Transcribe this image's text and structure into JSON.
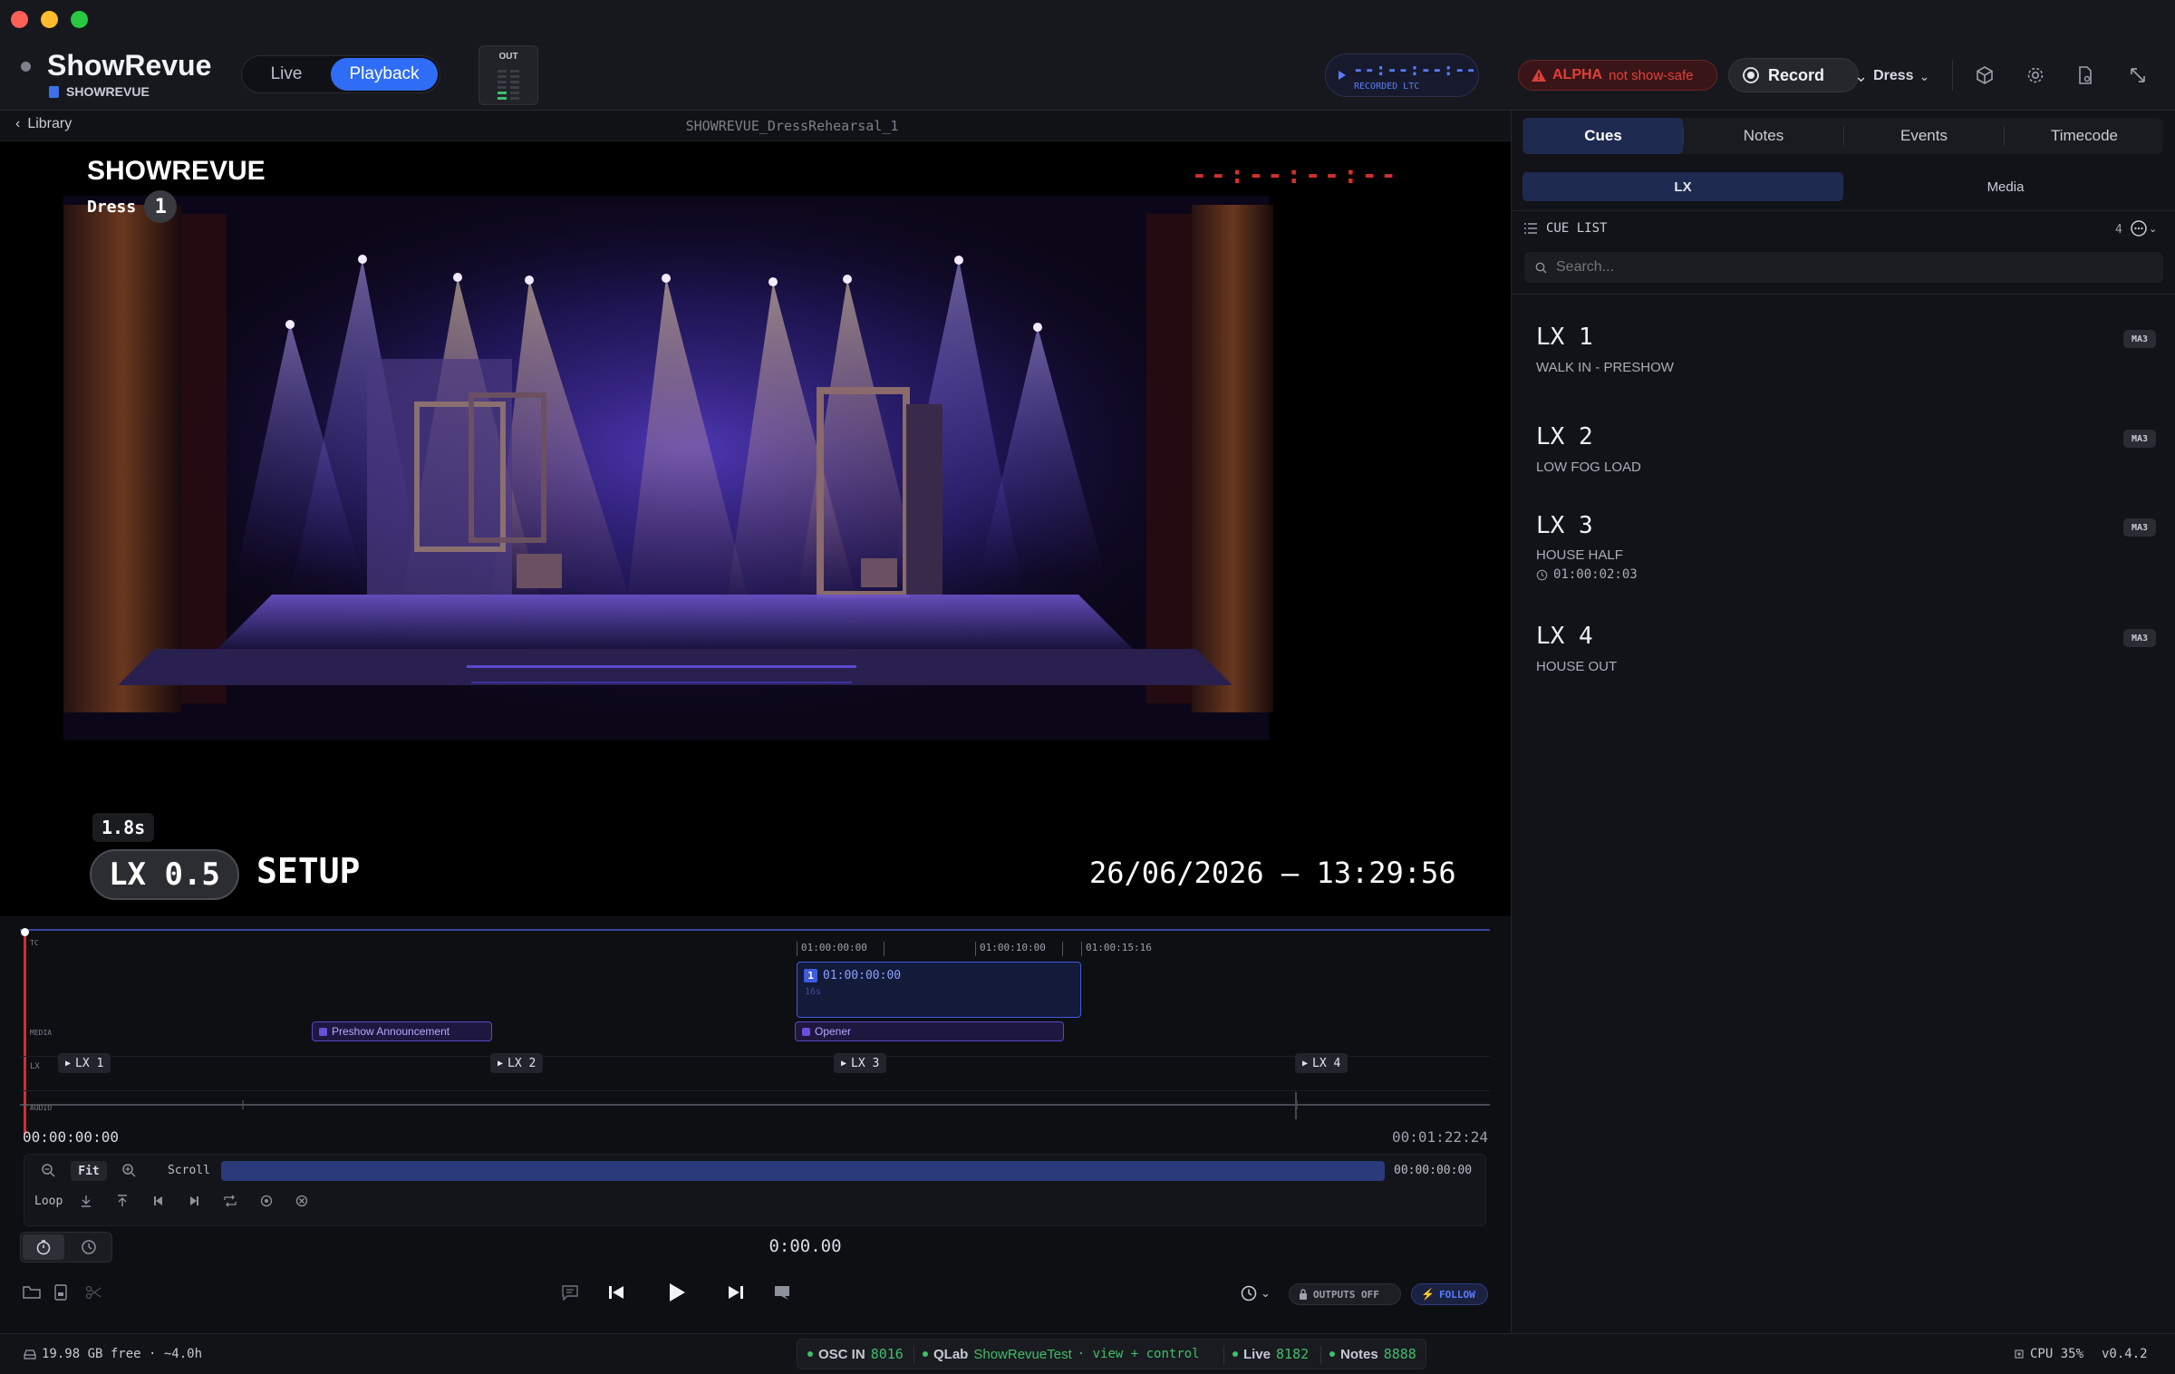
{
  "app": {
    "name": "ShowRevue",
    "project": "SHOWREVUE"
  },
  "mode": {
    "live": "Live",
    "playback": "Playback"
  },
  "meter": {
    "label": "OUT"
  },
  "ltc": {
    "value": "--:--:--:--",
    "label": "RECORDED LTC"
  },
  "alpha": {
    "tag": "ALPHA",
    "text": "not show-safe"
  },
  "record": {
    "label": "Record"
  },
  "dress": {
    "label": "Dress"
  },
  "library": {
    "label": "Library",
    "filename": "SHOWREVUE_DressRehearsal_1"
  },
  "overlay": {
    "title": "SHOWREVUE",
    "dress_label": "Dress",
    "dress_num": "1",
    "timecode": "--:--:--:--",
    "elapsed": "1.8s",
    "cue_badge": "LX 0.5",
    "cue_name": "SETUP",
    "datetime": "26/06/2026 – 13:29:56"
  },
  "timeline": {
    "ruler": [
      "01:00:00:00",
      "01:00:10:00",
      "01:00:15:16"
    ],
    "lanes": {
      "tc": "TC",
      "media": "MEDIA",
      "lx": "LX",
      "audio": "AUDIO"
    },
    "tc_block": {
      "num": "1",
      "time": "01:00:00:00",
      "sub": "16s"
    },
    "media": [
      "Preshow Announcement",
      "Opener"
    ],
    "lx": [
      "LX 1",
      "LX 2",
      "LX 3",
      "LX 4"
    ],
    "start": "00:00:00:00",
    "end": "00:01:22:24",
    "fit": "Fit",
    "scroll": "Scroll",
    "scroll_time": "00:00:00:00",
    "loop": "Loop",
    "clock": "0:00.00",
    "outputs": "OUTPUTS OFF",
    "follow": "FOLLOW"
  },
  "tabs": [
    "Cues",
    "Notes",
    "Events",
    "Timecode"
  ],
  "subtabs": [
    "LX",
    "Media"
  ],
  "cuelist": {
    "title": "CUE LIST",
    "count": "4",
    "search_placeholder": "Search...",
    "items": [
      {
        "id": "LX 1",
        "name": "WALK IN - PRESHOW",
        "badge": "MA3",
        "time": ""
      },
      {
        "id": "LX 2",
        "name": "LOW FOG LOAD",
        "badge": "MA3",
        "time": ""
      },
      {
        "id": "LX 3",
        "name": "HOUSE HALF",
        "badge": "MA3",
        "time": "01:00:02:03"
      },
      {
        "id": "LX 4",
        "name": "HOUSE OUT",
        "badge": "MA3",
        "time": ""
      }
    ]
  },
  "status": {
    "disk": "19.98 GB free · ~4.0h",
    "osc_label": "OSC IN",
    "osc_port": "8016",
    "qlab_label": "QLab",
    "qlab_name": "ShowRevueTest",
    "qlab_mode": "· view + control",
    "live_label": "Live",
    "live_port": "8182",
    "notes_label": "Notes",
    "notes_port": "8888",
    "cpu": "CPU 35%",
    "version": "v0.4.2"
  },
  "colors": {
    "accent": "#2f6df6",
    "record_red": "#e0403a",
    "green": "#3fbf6a",
    "ltc_blue": "#5b7cff",
    "media_purple": "#6b4fd8"
  }
}
